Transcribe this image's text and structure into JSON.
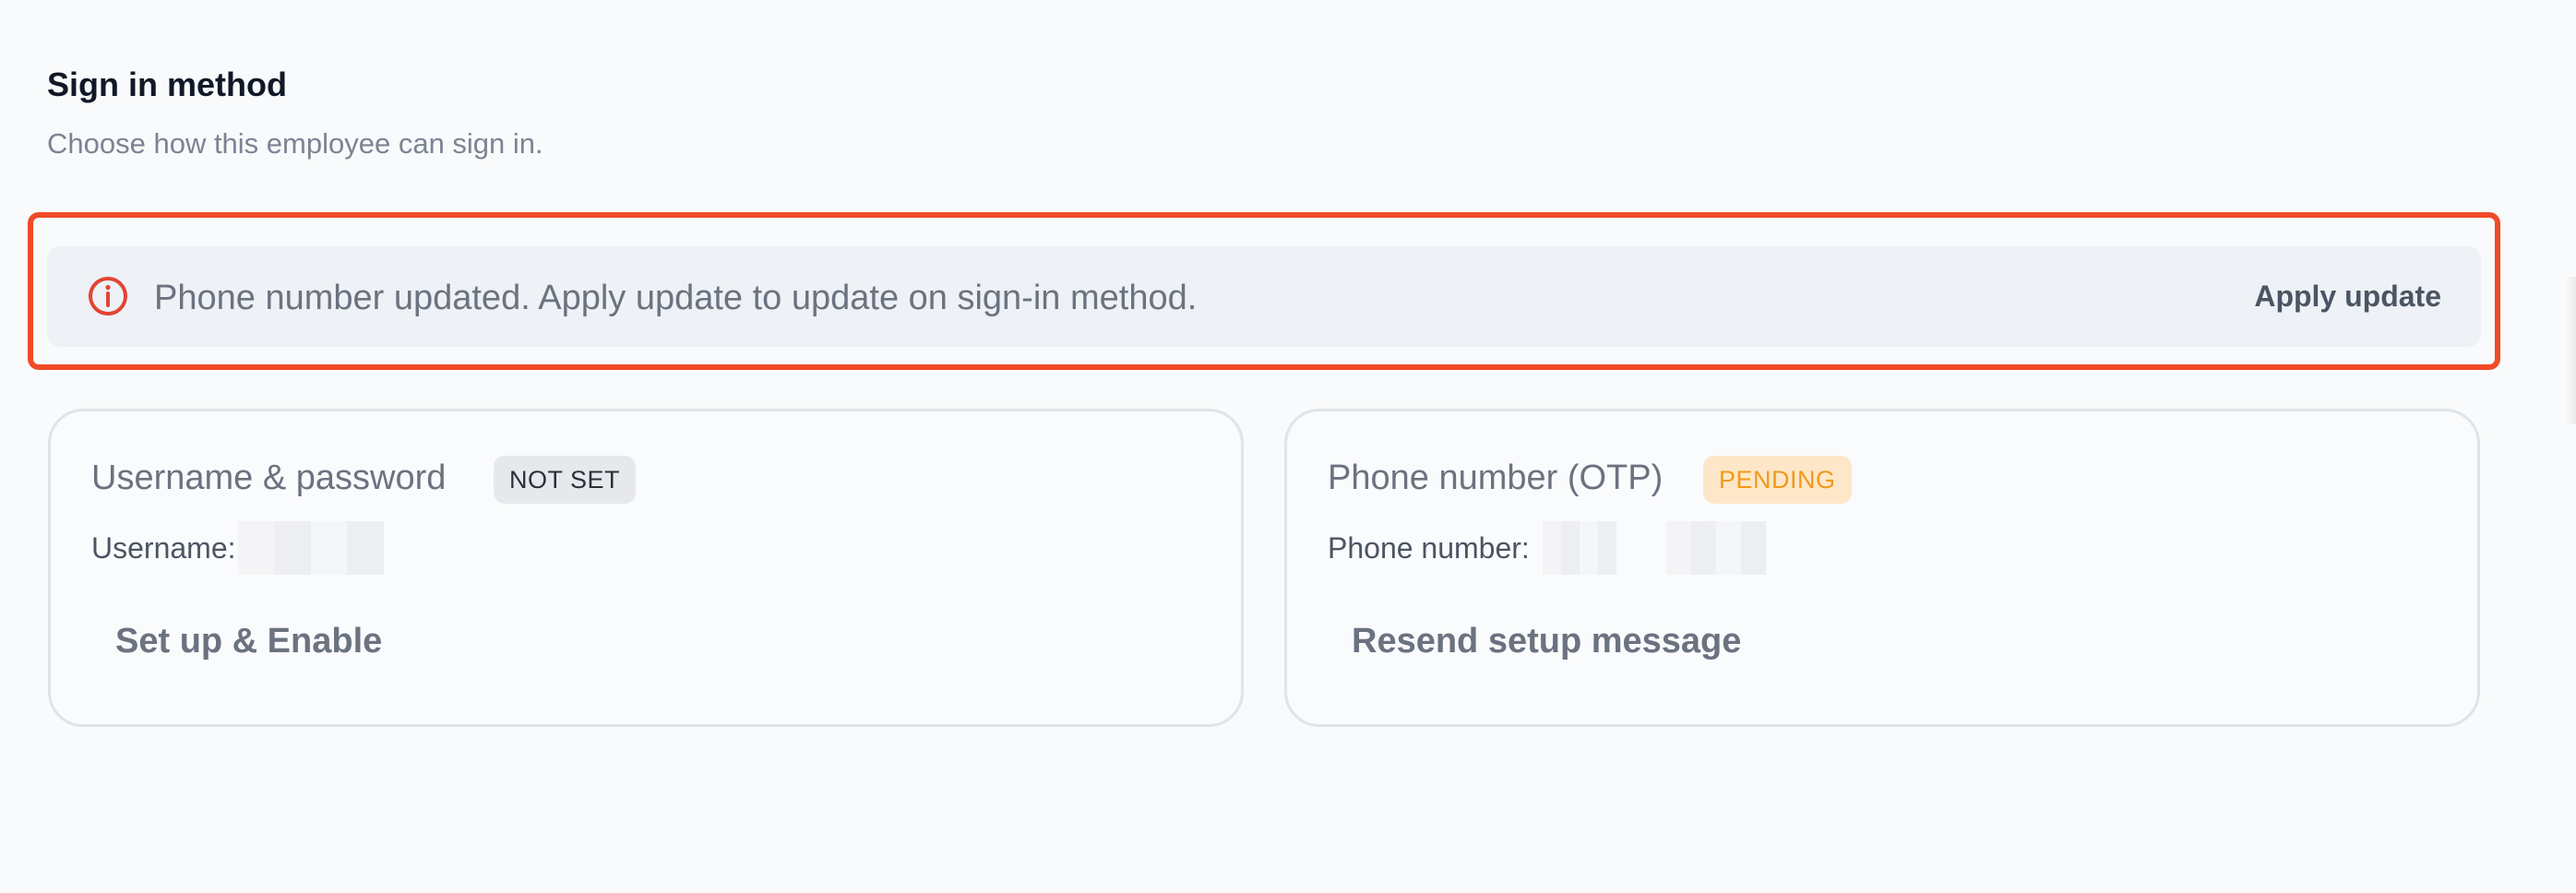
{
  "section": {
    "title": "Sign in method",
    "subtitle": "Choose how this employee can sign in."
  },
  "alert": {
    "icon": "info-circle-icon",
    "icon_color": "#e34434",
    "message": "Phone number updated. Apply update to update on sign-in method.",
    "action_label": "Apply update",
    "highlight_color": "#f14a28"
  },
  "cards": [
    {
      "title": "Username & password",
      "badge": "NOT SET",
      "field_label": "Username:",
      "action_label": "Set up & Enable"
    },
    {
      "title": "Phone number (OTP)",
      "badge": "PENDING",
      "badge_color": "#f09a1a",
      "field_label": "Phone number:",
      "action_label": "Resend setup message"
    }
  ]
}
